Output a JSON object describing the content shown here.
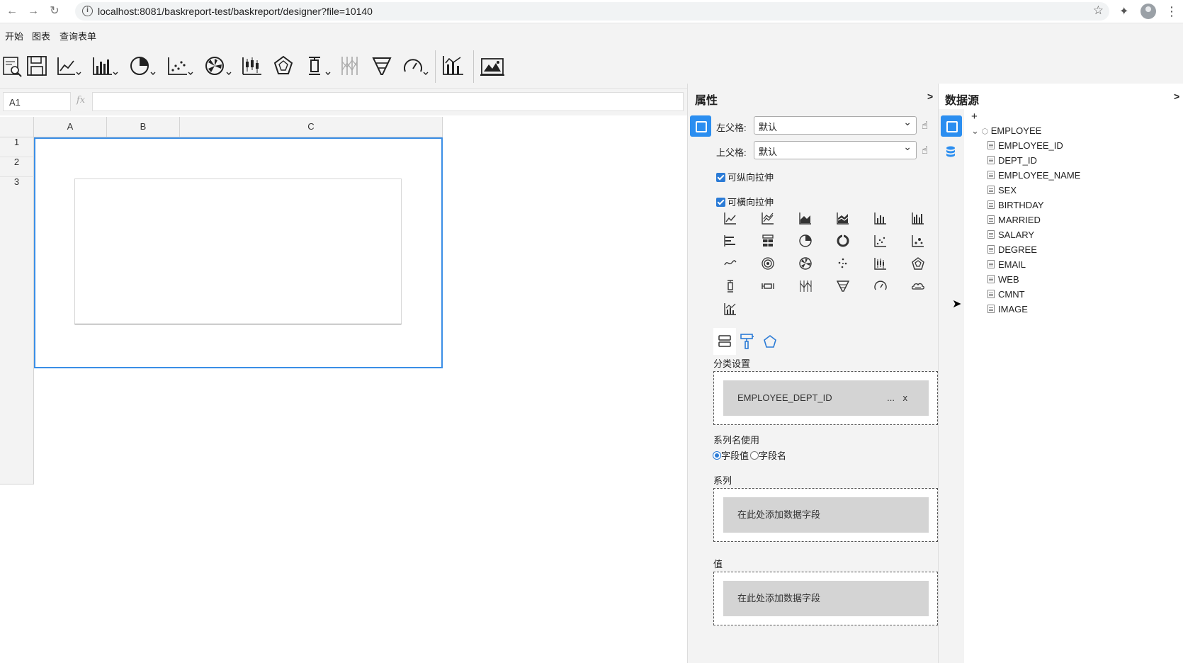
{
  "browser": {
    "url": "localhost:8081/baskreport-test/baskreport/designer?file=10140"
  },
  "app_tabs": [
    "开始",
    "图表",
    "查询表单"
  ],
  "formula_bar": {
    "cell_ref": "A1",
    "fx": "fx",
    "value": ""
  },
  "sheet": {
    "columns": [
      "A",
      "B",
      "C"
    ],
    "rows": [
      "1",
      "2",
      "3"
    ]
  },
  "properties": {
    "title": "属性",
    "collapse": ">",
    "left_parent_label": "左父格:",
    "left_parent_value": "默认",
    "top_parent_label": "上父格:",
    "top_parent_value": "默认",
    "vertical_stretch": "可纵向拉伸",
    "horizontal_stretch": "可横向拉伸",
    "category_label": "分类设置",
    "category_field": "EMPLOYEE_DEPT_ID",
    "category_more": "...",
    "category_close": "x",
    "series_name_label": "系列名使用",
    "radio_field_value": "字段值",
    "radio_field_name": "字段名",
    "series_label": "系列",
    "series_placeholder": "在此处添加数据字段",
    "value_label": "值",
    "value_placeholder": "在此处添加数据字段"
  },
  "datasource": {
    "title": "数据源",
    "collapse": ">",
    "add": "+",
    "root": "EMPLOYEE",
    "fields": [
      "EMPLOYEE_ID",
      "DEPT_ID",
      "EMPLOYEE_NAME",
      "SEX",
      "BIRTHDAY",
      "MARRIED",
      "SALARY",
      "DEGREE",
      "EMAIL",
      "WEB",
      "CMNT",
      "IMAGE"
    ]
  },
  "colors": {
    "accent": "#2b7bd6",
    "panel_bg": "#f3f3f3",
    "selection": "#3a8ee6"
  }
}
